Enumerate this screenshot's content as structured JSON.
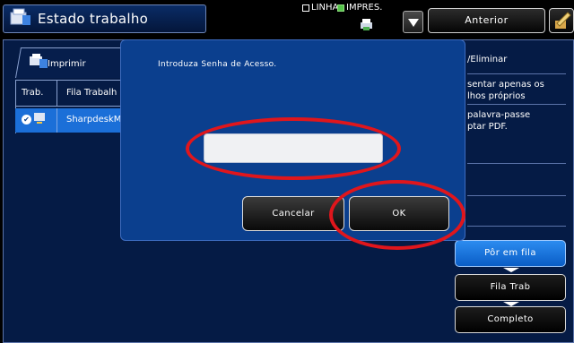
{
  "header": {
    "title": "Estado trabalho",
    "mode_linha": "LINHA",
    "mode_impres": "IMPRES.",
    "back_label": "Anterior"
  },
  "print_tab": {
    "label": "Imprimir"
  },
  "job_table": {
    "columns": [
      "Trab.",
      "Fila Trabalh"
    ],
    "rows": [
      {
        "name": "SharpdeskM"
      }
    ]
  },
  "right_panel": {
    "eliminar": "/Eliminar",
    "apenas": "sentar apenas os\nlhos próprios",
    "senha": "palavra-passe\nptar PDF."
  },
  "queue_buttons": {
    "por_em_fila": "Pôr em fila",
    "fila_trab": "Fila Trab",
    "completo": "Completo"
  },
  "dialog": {
    "prompt": "Introduza Senha de Acesso.",
    "password_value": "",
    "cancel_label": "Cancelar",
    "ok_label": "OK"
  },
  "colors": {
    "panel_bg": "#051b45",
    "dialog_bg": "#0b3f8e",
    "selected_row": "#1b6fd8",
    "active_button": "#2c8cf0",
    "annotation": "#e0161c"
  }
}
